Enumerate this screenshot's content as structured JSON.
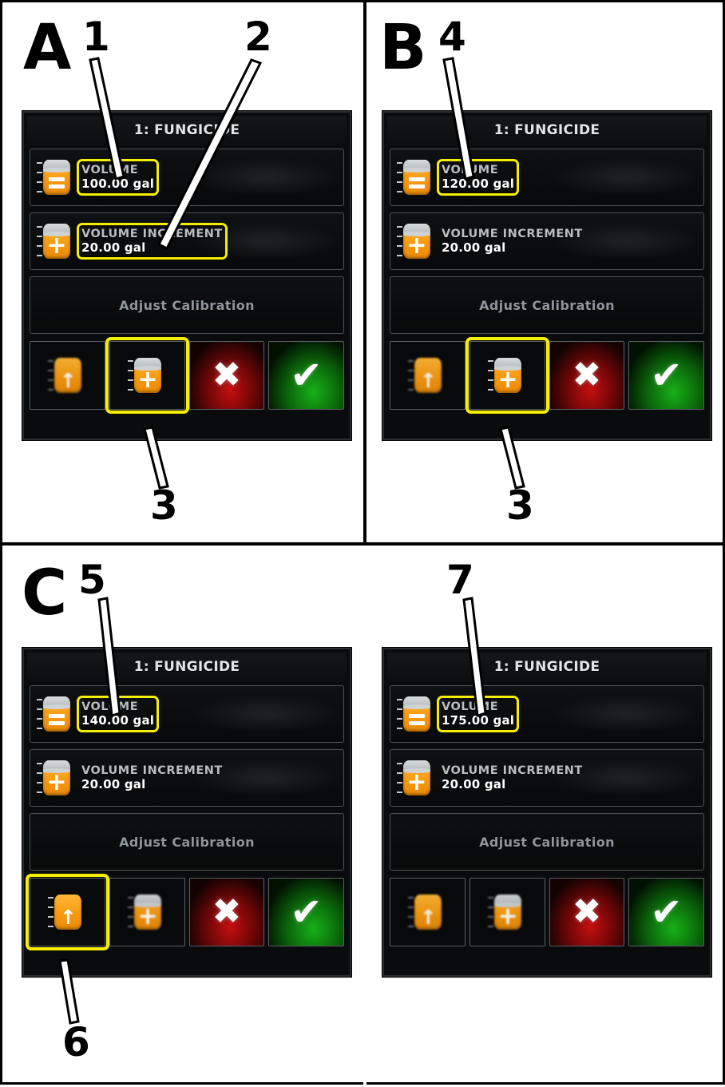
{
  "figure": {
    "type": "instructional-diagram",
    "panel_count": 4,
    "background": "#ffffff",
    "highlight_color": "#f5ee00"
  },
  "panels": [
    {
      "id": "A",
      "letter": "A",
      "callouts": [
        "1",
        "2",
        "3"
      ],
      "screen": {
        "title": "1: FUNGICIDE",
        "rows": [
          {
            "icon": "tank-equals-icon",
            "label": "VOLUME",
            "value": "100.00 gal",
            "highlighted": true
          },
          {
            "icon": "tank-plus-icon",
            "label": "VOLUME INCREMENT",
            "value": "20.00 gal",
            "highlighted": true
          }
        ],
        "calibration_label": "Adjust Calibration",
        "buttons": [
          {
            "icon": "tank-arrow-up-icon",
            "name": "fill-tank-button",
            "selected": false,
            "dim": true
          },
          {
            "icon": "tank-plus-icon",
            "name": "add-increment-button",
            "selected": true,
            "dim": false
          },
          {
            "icon": "x-icon",
            "glyph": "✖",
            "name": "cancel-button",
            "selected": false
          },
          {
            "icon": "check-icon",
            "glyph": "✔",
            "name": "confirm-button",
            "selected": false
          }
        ]
      }
    },
    {
      "id": "B",
      "letter": "B",
      "callouts": [
        "4",
        "3"
      ],
      "screen": {
        "title": "1: FUNGICIDE",
        "rows": [
          {
            "icon": "tank-equals-icon",
            "label": "VOLUME",
            "value": "120.00 gal",
            "highlighted": true
          },
          {
            "icon": "tank-plus-icon",
            "label": "VOLUME INCREMENT",
            "value": "20.00 gal",
            "highlighted": false
          }
        ],
        "calibration_label": "Adjust Calibration",
        "buttons": [
          {
            "icon": "tank-arrow-up-icon",
            "name": "fill-tank-button",
            "selected": false,
            "dim": true
          },
          {
            "icon": "tank-plus-icon",
            "name": "add-increment-button",
            "selected": true,
            "dim": false
          },
          {
            "icon": "x-icon",
            "glyph": "✖",
            "name": "cancel-button",
            "selected": false
          },
          {
            "icon": "check-icon",
            "glyph": "✔",
            "name": "confirm-button",
            "selected": false
          }
        ]
      }
    },
    {
      "id": "C",
      "letter": "C",
      "callouts": [
        "5",
        "6"
      ],
      "screen": {
        "title": "1: FUNGICIDE",
        "rows": [
          {
            "icon": "tank-equals-icon",
            "label": "VOLUME",
            "value": "140.00 gal",
            "highlighted": true
          },
          {
            "icon": "tank-plus-icon",
            "label": "VOLUME INCREMENT",
            "value": "20.00 gal",
            "highlighted": false
          }
        ],
        "calibration_label": "Adjust Calibration",
        "buttons": [
          {
            "icon": "tank-arrow-up-icon",
            "name": "fill-tank-button",
            "selected": true,
            "dim": false
          },
          {
            "icon": "tank-plus-icon",
            "name": "add-increment-button",
            "selected": false,
            "dim": true
          },
          {
            "icon": "x-icon",
            "glyph": "✖",
            "name": "cancel-button",
            "selected": false
          },
          {
            "icon": "check-icon",
            "glyph": "✔",
            "name": "confirm-button",
            "selected": false
          }
        ]
      }
    },
    {
      "id": "D",
      "letter": "",
      "callouts": [
        "7"
      ],
      "screen": {
        "title": "1: FUNGICIDE",
        "rows": [
          {
            "icon": "tank-equals-icon",
            "label": "VOLUME",
            "value": "175.00 gal",
            "highlighted": true
          },
          {
            "icon": "tank-plus-icon",
            "label": "VOLUME INCREMENT",
            "value": "20.00 gal",
            "highlighted": false
          }
        ],
        "calibration_label": "Adjust Calibration",
        "buttons": [
          {
            "icon": "tank-arrow-up-icon",
            "name": "fill-tank-button",
            "selected": false,
            "dim": true
          },
          {
            "icon": "tank-plus-icon",
            "name": "add-increment-button",
            "selected": false,
            "dim": true
          },
          {
            "icon": "x-icon",
            "glyph": "✖",
            "name": "cancel-button",
            "selected": false
          },
          {
            "icon": "check-icon",
            "glyph": "✔",
            "name": "confirm-button",
            "selected": false
          }
        ]
      }
    }
  ],
  "labels": {
    "A": "A",
    "B": "B",
    "C": "C",
    "n1": "1",
    "n2": "2",
    "n3": "3",
    "n3b": "3",
    "n4": "4",
    "n5": "5",
    "n6": "6",
    "n7": "7"
  },
  "glyphs": {
    "x": "✖",
    "check": "✔",
    "arrow_up": "↑",
    "plus": "+"
  }
}
